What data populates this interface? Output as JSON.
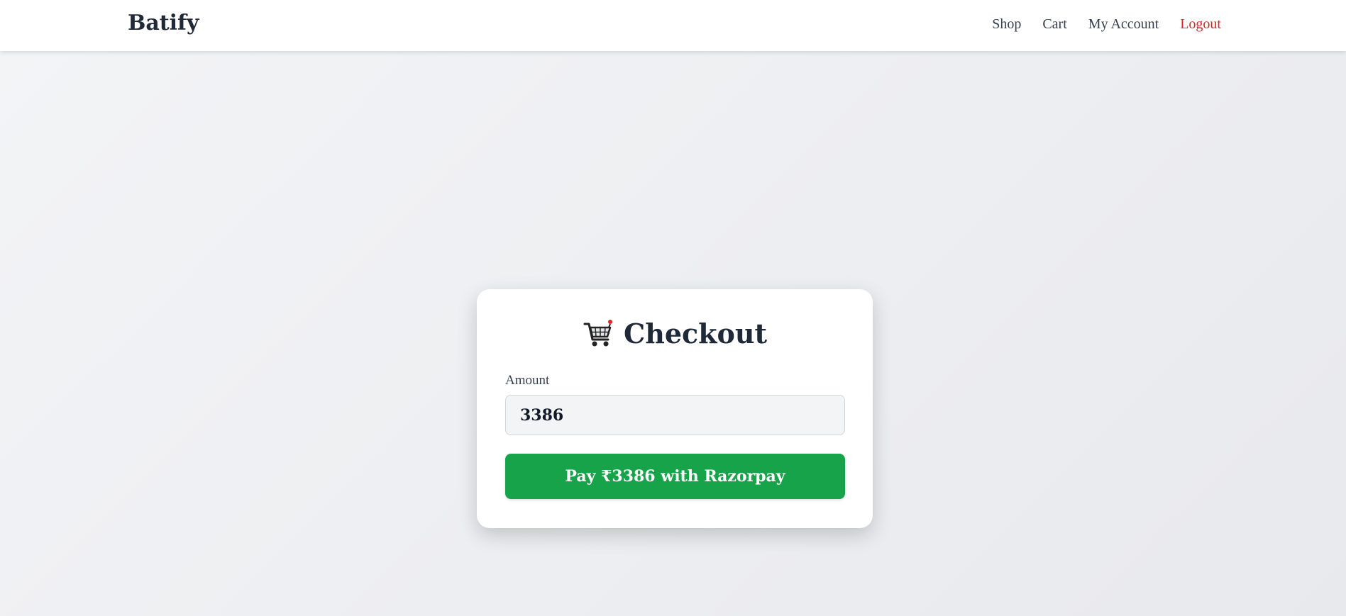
{
  "nav": {
    "brand": "Batify",
    "links": [
      {
        "label": "Shop"
      },
      {
        "label": "Cart"
      },
      {
        "label": "My Account"
      },
      {
        "label": "Logout"
      }
    ]
  },
  "checkout": {
    "icon": "shopping-cart-icon",
    "title": "Checkout",
    "amount_label": "Amount",
    "amount_value": "3386",
    "pay_button_label": "Pay ₹3386 with Razorpay"
  },
  "colors": {
    "accent_green": "#16a34a",
    "logout_red": "#dc2626",
    "text_dark": "#1f2937"
  }
}
